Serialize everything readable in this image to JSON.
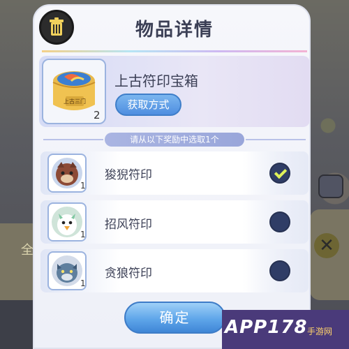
{
  "dialog": {
    "title": "物品详情",
    "item": {
      "name": "上古符印宝箱",
      "count": "2",
      "label_on_chest": "上古三门",
      "obtain_label": "获取方式"
    },
    "hint": "请从以下奖励中选取1个",
    "rewards": [
      {
        "name": "狻猊符印",
        "qty": "1",
        "selected": true,
        "icon": "red-beast-icon"
      },
      {
        "name": "招风符印",
        "qty": "1",
        "selected": false,
        "icon": "white-bird-icon"
      },
      {
        "name": "贪狼符印",
        "qty": "1",
        "selected": false,
        "icon": "blue-wolf-icon"
      }
    ],
    "confirm_label": "确定"
  },
  "background": {
    "left_label": "全"
  },
  "watermark": {
    "text": "APP178",
    "sub": "手游网"
  },
  "colors": {
    "accent_blue": "#4f8ee0",
    "radio": "#2f3d66",
    "check": "#dff15a",
    "title_text": "#3b3f55"
  }
}
